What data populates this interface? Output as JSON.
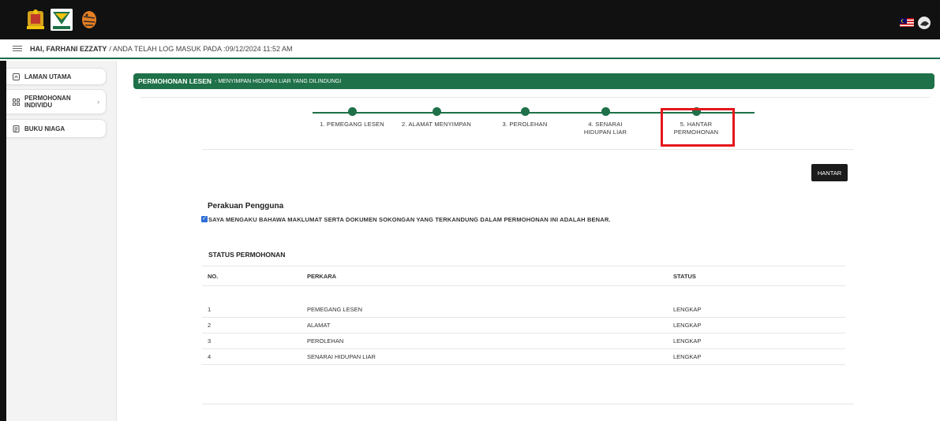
{
  "infobar": {
    "greeting": "HAI, FARHANI EZZATY",
    "login_text": "/ ANDA TELAH LOG MASUK PADA :09/12/2024 11:52 AM"
  },
  "sidebar": {
    "items": [
      {
        "label": "LAMAN UTAMA",
        "icon": "home-icon"
      },
      {
        "label": "PERMOHONAN INDIVIDU",
        "icon": "grid-icon",
        "has_submenu": true
      },
      {
        "label": "BUKU NIAGA",
        "icon": "document-icon"
      }
    ]
  },
  "header": {
    "title": "PERMOHONAN LESEN",
    "subtitle": "- MENYIMPAN HIDUPAN LIAR YANG DILINDUNGI"
  },
  "stepper": {
    "steps": [
      {
        "label": "1. PEMEGANG LESEN"
      },
      {
        "label": "2. ALAMAT MENYIMPAN"
      },
      {
        "label": "3. PEROLEHAN"
      },
      {
        "label": "4. SENARAI HIDUPAN LIAR"
      },
      {
        "label": "5. HANTAR PERMOHONAN",
        "current": true
      }
    ]
  },
  "actions": {
    "submit_label": "HANTAR"
  },
  "declaration": {
    "title": "Perakuan Pengguna",
    "text": "SAYA MENGAKU BAHAWA MAKLUMAT SERTA DOKUMEN SOKONGAN YANG TERKANDUNG DALAM PERMOHONAN INI ADALAH BENAR.",
    "checked": true
  },
  "status_table": {
    "title": "STATUS PERMOHONAN",
    "columns": [
      "NO.",
      "PERKARA",
      "STATUS"
    ],
    "rows": [
      [
        "1",
        "PEMEGANG LESEN",
        "LENGKAP"
      ],
      [
        "2",
        "ALAMAT",
        "LENGKAP"
      ],
      [
        "3",
        "PEROLEHAN",
        "LENGKAP"
      ],
      [
        "4",
        "SENARAI HIDUPAN LIAR",
        "LENGKAP"
      ]
    ]
  },
  "colors": {
    "brand_green": "#1e7148",
    "highlight_red": "#e3171c",
    "checkbox_blue": "#2f6fd6"
  }
}
